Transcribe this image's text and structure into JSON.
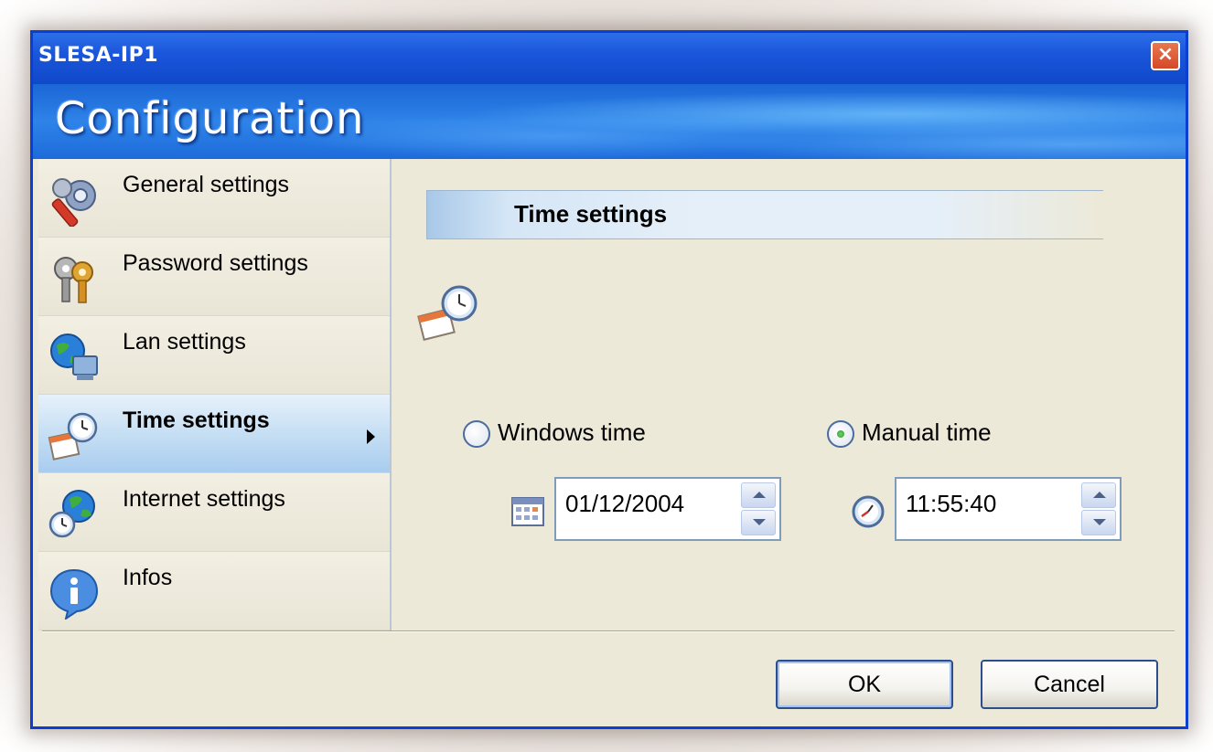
{
  "window": {
    "title": "SLESA-IP1",
    "close_label": "×",
    "banner": "Configuration"
  },
  "sidebar": {
    "items": [
      {
        "label": "General settings",
        "icon": "wrench-gear-icon",
        "active": false
      },
      {
        "label": "Password settings",
        "icon": "keys-icon",
        "active": false
      },
      {
        "label": "Lan settings",
        "icon": "globe-computer-icon",
        "active": false
      },
      {
        "label": "Time settings",
        "icon": "calendar-clock-icon",
        "active": true
      },
      {
        "label": "Internet settings",
        "icon": "globe-clock-icon",
        "active": false
      },
      {
        "label": "Infos",
        "icon": "info-icon",
        "active": false
      }
    ]
  },
  "main": {
    "section_title": "Time settings",
    "section_icon": "calendar-clock-icon",
    "windows_time_label": "Windows time",
    "manual_time_label": "Manual time",
    "selected_mode": "Manual time",
    "date_value": "01/12/2004",
    "time_value": "11:55:40"
  },
  "buttons": {
    "ok": "OK",
    "cancel": "Cancel"
  },
  "colors": {
    "titlebar": "#1a56db",
    "window_bg": "#ece9d8",
    "active_item": "#c3ddf3"
  }
}
